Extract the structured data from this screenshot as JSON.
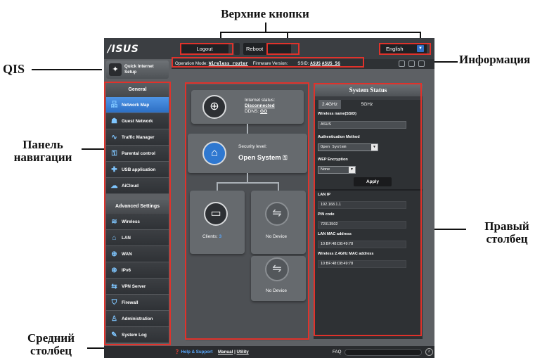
{
  "annotations": {
    "top_buttons": "Верхние кнопки",
    "info": "Информация",
    "qis": "QIS",
    "nav_panel_1": "Панель",
    "nav_panel_2": "навигации",
    "right_column_1": "Правый",
    "right_column_2": "столбец",
    "middle_column_1": "Средний",
    "middle_column_2": "столбец"
  },
  "colors": {
    "highlight": "#e0322b",
    "accent": "#2f78d0"
  },
  "header": {
    "logo": "/ISUS",
    "logout": "Logout",
    "reboot": "Reboot",
    "language": "English"
  },
  "infobar": {
    "op_mode_label": "Operation Mode:",
    "op_mode_value": "Wireless router",
    "firmware_label": "Firmware Version:",
    "ssid_label": "SSID:",
    "ssid_1": "ASUS",
    "ssid_2": "ASUS_5G"
  },
  "qis": {
    "line1": "Quick Internet",
    "line2": "Setup"
  },
  "nav": {
    "general_header": "General",
    "general": [
      {
        "label": "Network Map",
        "icon": "network-map-icon",
        "glyph": "品",
        "active": true
      },
      {
        "label": "Guest Network",
        "icon": "guest-network-icon",
        "glyph": "☗",
        "active": false
      },
      {
        "label": "Traffic Manager",
        "icon": "traffic-manager-icon",
        "glyph": "∿",
        "active": false
      },
      {
        "label": "Parental control",
        "icon": "parental-control-icon",
        "glyph": "⚿",
        "active": false
      },
      {
        "label": "USB application",
        "icon": "usb-application-icon",
        "glyph": "✚",
        "active": false
      },
      {
        "label": "AiCloud",
        "icon": "aicloud-icon",
        "glyph": "☁",
        "active": false
      }
    ],
    "advanced_header": "Advanced Settings",
    "advanced": [
      {
        "label": "Wireless",
        "icon": "wireless-icon",
        "glyph": "≋"
      },
      {
        "label": "LAN",
        "icon": "lan-icon",
        "glyph": "⌂"
      },
      {
        "label": "WAN",
        "icon": "wan-icon",
        "glyph": "⊕"
      },
      {
        "label": "IPv6",
        "icon": "ipv6-icon",
        "glyph": "⊛"
      },
      {
        "label": "VPN Server",
        "icon": "vpn-server-icon",
        "glyph": "⇆"
      },
      {
        "label": "Firewall",
        "icon": "firewall-icon",
        "glyph": "⛉"
      },
      {
        "label": "Administration",
        "icon": "administration-icon",
        "glyph": "♙"
      },
      {
        "label": "System Log",
        "icon": "system-log-icon",
        "glyph": "✎"
      }
    ]
  },
  "network_map": {
    "internet_status_label": "Internet status:",
    "internet_status_value": "Disconnected",
    "ddns_label": "DDNS:",
    "ddns_value": "GO",
    "security_label": "Security level:",
    "security_value": "Open System",
    "clients_label": "Clients:",
    "clients_count": "3",
    "usb1": "No Device",
    "usb2": "No Device"
  },
  "system_status": {
    "title": "System Status",
    "tab_24": "2.4GHz",
    "tab_5": "5GHz",
    "ssid_label": "Wireless name(SSID)",
    "ssid_value": "ASUS",
    "auth_label": "Authentication Method",
    "auth_value": "Open System",
    "wep_label": "WEP Encryption",
    "wep_value": "None",
    "apply": "Apply",
    "lan_ip_label": "LAN IP",
    "lan_ip_value": "192.168.1.1",
    "pin_label": "PIN code",
    "pin_value": "72013502",
    "lan_mac_label": "LAN MAC address",
    "lan_mac_value": "10:BF:48:D8:49:78",
    "wl_mac_label": "Wireless 2.4GHz MAC address",
    "wl_mac_value": "10:BF:48:D8:49:78"
  },
  "footer": {
    "help": "Help & Support",
    "manual": "Manual",
    "sep": "|",
    "utility": "Utility",
    "faq": "FAQ"
  }
}
